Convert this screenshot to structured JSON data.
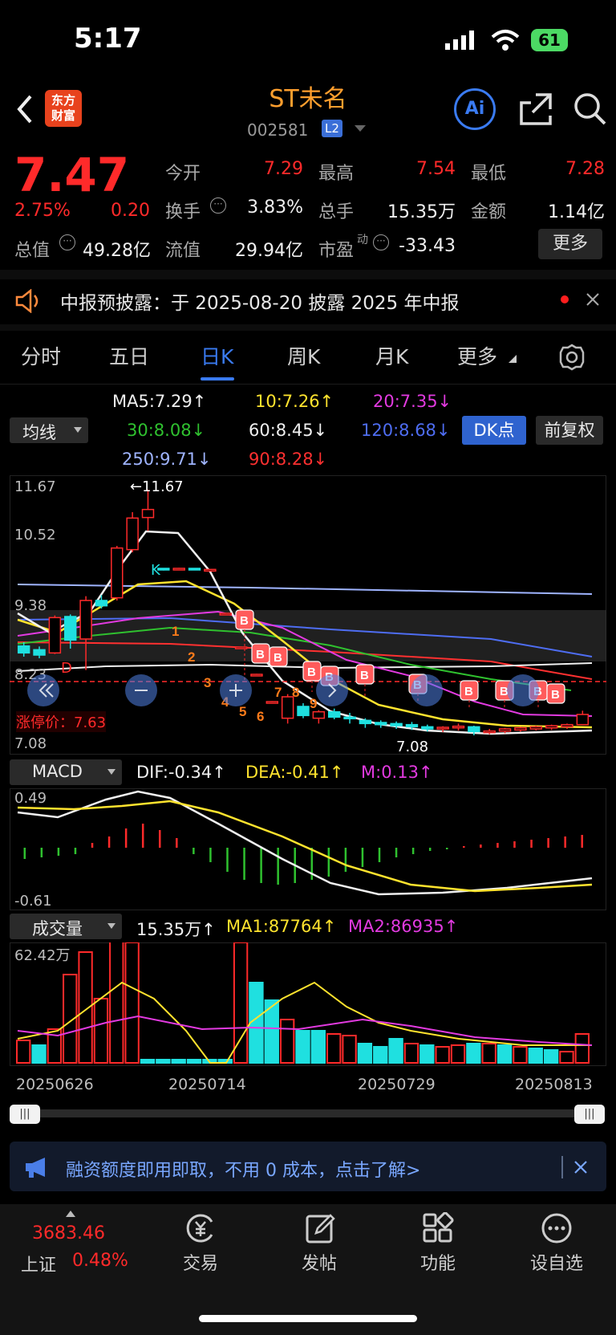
{
  "status_bar": {
    "time": "5:17",
    "battery": "61"
  },
  "header": {
    "title": "ST未名",
    "code": "002581",
    "level": "L2",
    "logo_text_1": "东方",
    "logo_text_2": "财富",
    "ai_label": "Ai"
  },
  "quote": {
    "price": "7.47",
    "change_pct": "2.75%",
    "change": "0.20",
    "open_label": "今开",
    "open": "7.29",
    "high_label": "最高",
    "high": "7.54",
    "low_label": "最低",
    "low": "7.28",
    "turnover_label": "换手",
    "turnover": "3.83%",
    "volume_label": "总手",
    "volume": "15.35万",
    "amount_label": "金额",
    "amount": "1.14亿",
    "mcap_label": "总值",
    "mcap": "49.28亿",
    "float_label": "流值",
    "float": "29.94亿",
    "pe_label": "市盈",
    "pe_sup": "动",
    "pe": "-33.43",
    "more_label": "更多"
  },
  "notice": {
    "text": "中报预披露：于 2025-08-20 披露 2025 年中报"
  },
  "tabs": [
    "分时",
    "五日",
    "日K",
    "周K",
    "月K",
    "更多"
  ],
  "active_tab": "日K",
  "ma_bar": {
    "selector": "均线",
    "ma5": "MA5:7.29↑",
    "ma10": "10:7.26↑",
    "ma20": "20:7.35↓",
    "ma30": "30:8.08↓",
    "ma60": "60:8.45↓",
    "ma120": "120:8.68↓",
    "ma250": "250:9.71↓",
    "ma90": "90:8.28↓",
    "dk_button": "DK点",
    "fq_button": "前复权"
  },
  "kline": {
    "y_ticks": [
      "11.67",
      "10.52",
      "9.38",
      "8.23",
      "7.08"
    ],
    "max_marker": "←11.67",
    "min_marker": "7.08",
    "limit_up_label": "涨停价：7.63",
    "k_marker": "K",
    "d_marker": "D"
  },
  "macd": {
    "selector": "MACD",
    "dif": "DIF:-0.34↑",
    "dea": "DEA:-0.41↑",
    "m": "M:0.13↑",
    "y_top": "0.49",
    "y_bottom": "-0.61"
  },
  "volume": {
    "selector": "成交量",
    "value": "15.35万↑",
    "ma1": "MA1:87764↑",
    "ma2": "MA2:86935↑",
    "y_top": "62.42万"
  },
  "dates": [
    "20250626",
    "20250714",
    "20250729",
    "20250813"
  ],
  "banner": {
    "text": "融资额度即用即取，不用 0 成本，点击了解>"
  },
  "bottom_nav": {
    "index_value": "3683.46",
    "index_name": "上证",
    "index_pct": "0.48%",
    "items": [
      "交易",
      "发帖",
      "功能",
      "设自选"
    ]
  },
  "colors": {
    "up": "#ff2a2a",
    "down": "#1fe0e0",
    "accent": "#3a7bf2",
    "title": "#ff9f2e"
  },
  "chart_data": {
    "type": "candlestick",
    "ylim": [
      7.08,
      11.67
    ],
    "candles": [
      {
        "o": 8.75,
        "c": 8.62,
        "h": 8.82,
        "l": 8.55
      },
      {
        "o": 8.68,
        "c": 8.58,
        "h": 8.74,
        "l": 8.52
      },
      {
        "o": 8.62,
        "c": 9.28,
        "h": 9.32,
        "l": 8.6
      },
      {
        "o": 9.3,
        "c": 8.86,
        "h": 9.34,
        "l": 8.7
      },
      {
        "o": 8.88,
        "c": 9.6,
        "h": 9.68,
        "l": 8.3
      },
      {
        "o": 9.6,
        "c": 9.5,
        "h": 9.7,
        "l": 9.45
      },
      {
        "o": 9.65,
        "c": 10.58,
        "h": 10.62,
        "l": 9.6
      },
      {
        "o": 10.55,
        "c": 11.14,
        "h": 11.25,
        "l": 10.5
      },
      {
        "o": 11.15,
        "c": 11.3,
        "h": 11.67,
        "l": 10.9
      },
      {
        "o": 10.2,
        "c": 10.18,
        "h": 10.2,
        "l": 10.16
      },
      {
        "o": 10.19,
        "c": 10.2,
        "h": 10.21,
        "l": 10.18
      },
      {
        "o": 10.2,
        "c": 10.19,
        "h": 10.2,
        "l": 10.18
      },
      {
        "o": 10.18,
        "c": 10.18,
        "h": 10.18,
        "l": 10.18
      },
      {
        "o": 9.35,
        "c": 9.36,
        "h": 9.37,
        "l": 9.34
      },
      {
        "o": 8.72,
        "c": 8.73,
        "h": 8.74,
        "l": 8.71
      },
      {
        "o": 8.21,
        "c": 8.22,
        "h": 8.23,
        "l": 8.2
      },
      {
        "o": 7.7,
        "c": 7.71,
        "h": 7.72,
        "l": 7.69
      },
      {
        "o": 7.4,
        "c": 7.8,
        "h": 7.85,
        "l": 7.3
      },
      {
        "o": 7.62,
        "c": 7.45,
        "h": 7.68,
        "l": 7.4
      },
      {
        "o": 7.4,
        "c": 7.52,
        "h": 7.55,
        "l": 7.3
      },
      {
        "o": 7.52,
        "c": 7.42,
        "h": 7.58,
        "l": 7.38
      },
      {
        "o": 7.42,
        "c": 7.4,
        "h": 7.5,
        "l": 7.3
      },
      {
        "o": 7.36,
        "c": 7.3,
        "h": 7.4,
        "l": 7.22
      },
      {
        "o": 7.32,
        "c": 7.28,
        "h": 7.36,
        "l": 7.22
      },
      {
        "o": 7.3,
        "c": 7.26,
        "h": 7.34,
        "l": 7.2
      },
      {
        "o": 7.28,
        "c": 7.24,
        "h": 7.33,
        "l": 7.18
      },
      {
        "o": 7.24,
        "c": 7.2,
        "h": 7.28,
        "l": 7.15
      },
      {
        "o": 7.2,
        "c": 7.23,
        "h": 7.25,
        "l": 7.14
      },
      {
        "o": 7.22,
        "c": 7.25,
        "h": 7.3,
        "l": 7.17
      },
      {
        "o": 7.24,
        "c": 7.15,
        "h": 7.26,
        "l": 7.08
      },
      {
        "o": 7.14,
        "c": 7.16,
        "h": 7.2,
        "l": 7.1
      },
      {
        "o": 7.16,
        "c": 7.2,
        "h": 7.22,
        "l": 7.12
      },
      {
        "o": 7.18,
        "c": 7.22,
        "h": 7.24,
        "l": 7.15
      },
      {
        "o": 7.2,
        "c": 7.24,
        "h": 7.26,
        "l": 7.17
      },
      {
        "o": 7.22,
        "c": 7.26,
        "h": 7.28,
        "l": 7.18
      },
      {
        "o": 7.24,
        "c": 7.28,
        "h": 7.3,
        "l": 7.2
      },
      {
        "o": 7.28,
        "c": 7.47,
        "h": 7.54,
        "l": 7.28
      }
    ]
  }
}
